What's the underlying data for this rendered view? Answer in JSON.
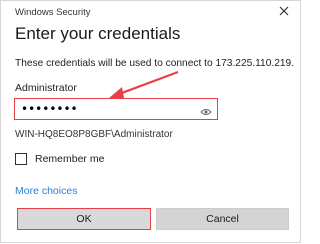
{
  "window": {
    "title": "Windows Security",
    "close_icon": "close-icon"
  },
  "heading": "Enter your credentials",
  "description": "These credentials will be used to connect to 173.225.110.219.",
  "username": "Administrator",
  "password": {
    "value": "••••••••",
    "reveal_icon": "eye-icon"
  },
  "domain_user": "WIN-HQ8EO8P8GBF\\Administrator",
  "remember": {
    "label": "Remember me",
    "checked": false
  },
  "more_choices": "More choices",
  "buttons": {
    "ok": "OK",
    "cancel": "Cancel"
  },
  "colors": {
    "highlight": "#e8404a",
    "link": "#2f7fd0",
    "button_bg": "#d9d9d9"
  }
}
